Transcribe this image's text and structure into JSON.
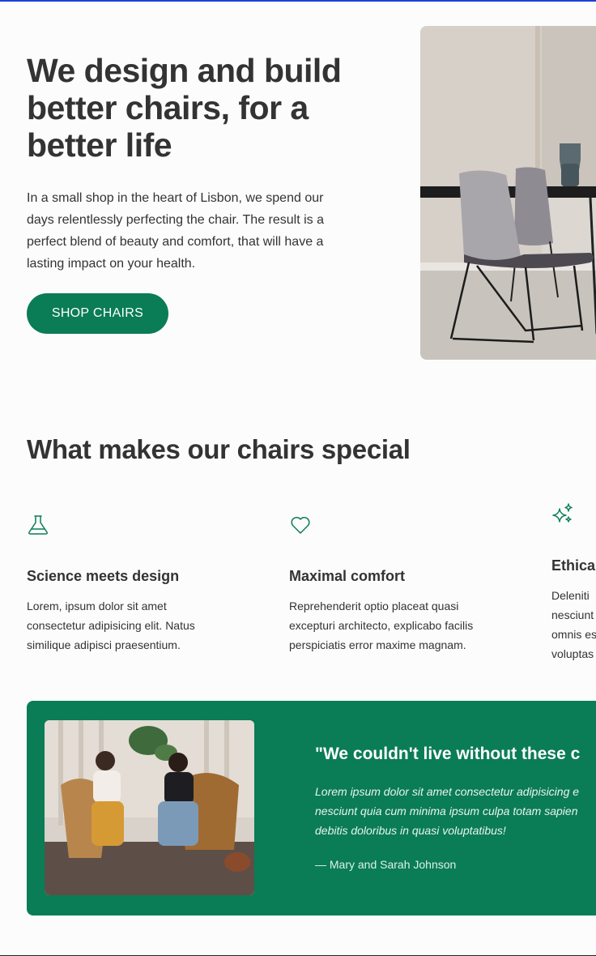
{
  "hero": {
    "title": "We design and build better chairs, for a better life",
    "text": "In a small shop in the heart of Lisbon, we spend our days relentlessly perfecting the chair. The result is a perfect blend of beauty and comfort, that will have a lasting impact on your health.",
    "cta_label": "SHOP CHAIRS"
  },
  "features": {
    "title": "What makes our chairs special",
    "items": [
      {
        "icon": "flask-icon",
        "title": "Science meets design",
        "lines": [
          "Lorem, ipsum dolor sit amet",
          "consectetur adipisicing elit. Natus",
          "similique adipisci praesentium."
        ]
      },
      {
        "icon": "heart-icon",
        "title": "Maximal comfort",
        "lines": [
          "Reprehenderit optio placeat quasi",
          "excepturi architecto, explicabo facilis",
          "perspiciatis error maxime magnam."
        ]
      },
      {
        "icon": "sparkles-icon",
        "title": "Ethical",
        "lines": [
          "Deleniti",
          "nesciunt",
          "omnis es",
          "voluptas"
        ]
      }
    ]
  },
  "testimonial": {
    "title": "\"We couldn't live without these c",
    "lines": [
      "Lorem ipsum dolor sit amet consectetur adipisicing e",
      "nesciunt quia cum minima ipsum culpa totam sapien",
      "debitis doloribus in quasi voluptatibus!"
    ],
    "author": "— Mary and Sarah Johnson"
  },
  "colors": {
    "brand_green": "#0a7c56",
    "text": "#333333",
    "top_bar": "#1f3fd6"
  }
}
